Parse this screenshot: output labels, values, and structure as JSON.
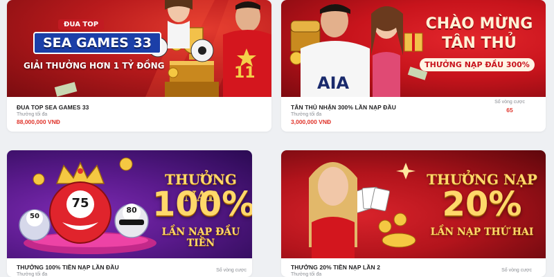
{
  "cards": [
    {
      "banner": {
        "tag": "ĐUA TOP",
        "headline": "SEA GAMES 33",
        "subline": "GIẢI THƯỞNG HƠN 1 TỶ ĐỒNG",
        "colors": {
          "bg": "#b81a1c",
          "bg2": "#7a0c10",
          "ribbon": "#1b3fa8"
        }
      },
      "title": "ĐUA TOP SEA GAMES 33",
      "sub_label": "Thưởng tối đa",
      "amount": "88,000,000 VNĐ"
    },
    {
      "banner": {
        "line1": "CHÀO MỪNG",
        "line2": "TÂN THỦ",
        "pill": "THƯỞNG NẠP ĐẦU 300%",
        "jersey": "AIA",
        "colors": {
          "bg": "#c8141c",
          "bg2": "#7d0a10",
          "pill": "#fff4e4"
        }
      },
      "title": "TÂN THỦ NHẬN 300% LẦN NẠP ĐẦU",
      "sub_label": "Thưởng tối đa",
      "amount": "3,000,000 VNĐ",
      "turns_label": "Số vòng cược",
      "turns_value": "65"
    },
    {
      "banner": {
        "line1": "THƯỞNG NẠP",
        "line2": "100%",
        "line3": "LẦN NẠP ĐẦU TIÊN",
        "ball_big": "75",
        "ball_left": "50",
        "ball_right": "80",
        "colors": {
          "bg": "#5a1a8c",
          "bg2": "#2a0a52"
        }
      },
      "title": "THƯỞNG 100% TIỀN NẠP LẦN ĐẦU",
      "sub_label": "Thưởng tối đa",
      "turns_label": "Số vòng cược"
    },
    {
      "banner": {
        "line1": "THƯỞNG NẠP",
        "line2": "20%",
        "line3": "LẦN NẠP THỨ HAI",
        "colors": {
          "bg": "#b3141c",
          "bg2": "#5e070c"
        }
      },
      "title": "THƯỞNG 20% TIỀN NẠP LẦN 2",
      "sub_label": "Thưởng tối đa",
      "turns_label": "Số vòng cược"
    }
  ]
}
